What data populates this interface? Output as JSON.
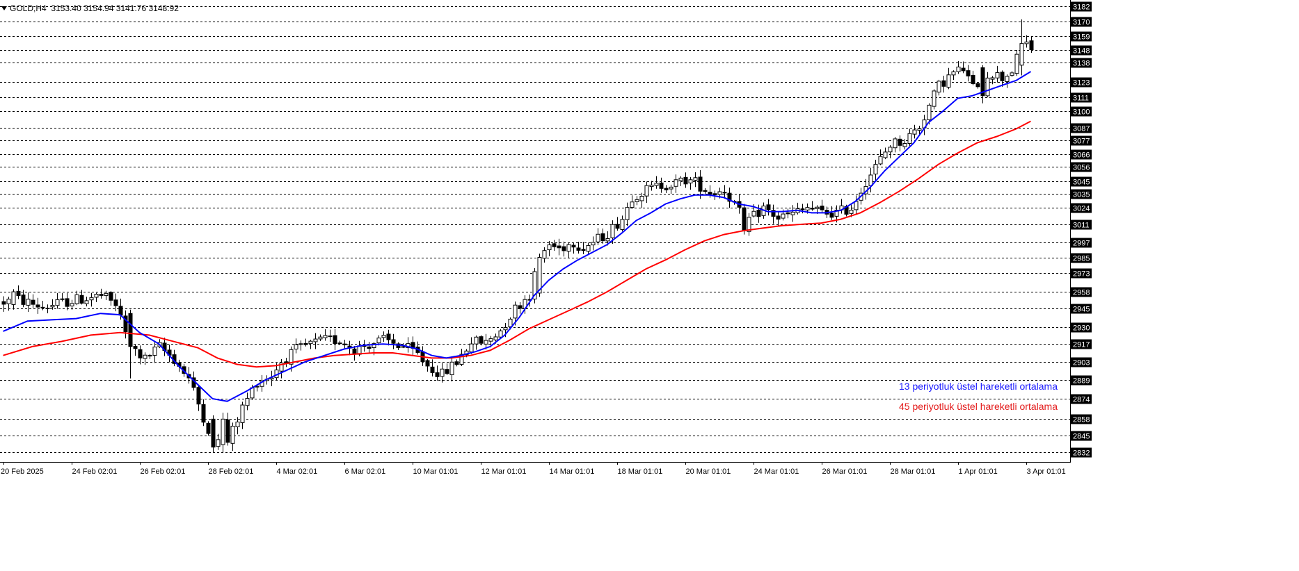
{
  "header": {
    "symbol": "GOLD,H4",
    "ohlc": "3153.40 3154.94 3141.76 3148.92"
  },
  "legend": {
    "ema13": "13 periyotluk üstel hareketli ortalama",
    "ema45": "45 periyotluk üstel hareketli ortalama"
  },
  "colors": {
    "ema13": "#0000ff",
    "ema45": "#ff0000",
    "grid": "#000000",
    "candle": "#000000",
    "background": "#ffffff"
  },
  "chart_data": {
    "type": "candlestick",
    "title": "",
    "symbol": "GOLD",
    "timeframe": "H4",
    "grid": true,
    "ylim": [
      2826,
      3185
    ],
    "y_tick_labels": [
      "3182",
      "3170",
      "3159",
      "3148",
      "3138",
      "3123",
      "3111",
      "3100",
      "3087",
      "3077",
      "3066",
      "3056",
      "3045",
      "3035",
      "3024",
      "3011",
      "2997",
      "2985",
      "2973",
      "2958",
      "2945",
      "2930",
      "2917",
      "2903",
      "2889",
      "2874",
      "2858",
      "2845",
      "2832"
    ],
    "x_tick_labels": [
      {
        "label": "20 Feb 2025",
        "bar": 0
      },
      {
        "label": "24 Feb 02:01",
        "bar": 14
      },
      {
        "label": "26 Feb 02:01",
        "bar": 28
      },
      {
        "label": "28 Feb 02:01",
        "bar": 42
      },
      {
        "label": "4 Mar 02:01",
        "bar": 56
      },
      {
        "label": "6 Mar 02:01",
        "bar": 70
      },
      {
        "label": "10 Mar 01:01",
        "bar": 84
      },
      {
        "label": "12 Mar 01:01",
        "bar": 98
      },
      {
        "label": "14 Mar 01:01",
        "bar": 112
      },
      {
        "label": "18 Mar 01:01",
        "bar": 126
      },
      {
        "label": "20 Mar 01:01",
        "bar": 140
      },
      {
        "label": "24 Mar 01:01",
        "bar": 154
      },
      {
        "label": "26 Mar 01:01",
        "bar": 168
      },
      {
        "label": "28 Mar 01:01",
        "bar": 182
      },
      {
        "label": "1 Apr 01:01",
        "bar": 196
      },
      {
        "label": "3 Apr 01:01",
        "bar": 210
      }
    ],
    "price_path": [
      [
        0,
        2950
      ],
      [
        3,
        2952
      ],
      [
        8,
        2946
      ],
      [
        14,
        2951
      ],
      [
        20,
        2955
      ],
      [
        23,
        2948
      ],
      [
        26,
        2915
      ],
      [
        29,
        2905
      ],
      [
        32,
        2915
      ],
      [
        35,
        2905
      ],
      [
        38,
        2890
      ],
      [
        40,
        2870
      ],
      [
        43,
        2840
      ],
      [
        46,
        2840
      ],
      [
        49,
        2867
      ],
      [
        52,
        2888
      ],
      [
        55,
        2892
      ],
      [
        57,
        2903
      ],
      [
        60,
        2912
      ],
      [
        63,
        2917
      ],
      [
        66,
        2920
      ],
      [
        69,
        2920
      ],
      [
        72,
        2913
      ],
      [
        75,
        2917
      ],
      [
        78,
        2920
      ],
      [
        82,
        2915
      ],
      [
        85,
        2909
      ],
      [
        87,
        2900
      ],
      [
        90,
        2893
      ],
      [
        93,
        2903
      ],
      [
        96,
        2919
      ],
      [
        99,
        2918
      ],
      [
        102,
        2928
      ],
      [
        105,
        2945
      ],
      [
        108,
        2956
      ],
      [
        110,
        2985
      ],
      [
        112,
        2995
      ],
      [
        114,
        2992
      ],
      [
        117,
        2997
      ],
      [
        119,
        2993
      ],
      [
        121,
        2997
      ],
      [
        124,
        3004
      ],
      [
        127,
        3016
      ],
      [
        129,
        3033
      ],
      [
        132,
        3038
      ],
      [
        135,
        3042
      ],
      [
        138,
        3043
      ],
      [
        140,
        3046
      ],
      [
        142,
        3044
      ],
      [
        145,
        3036
      ],
      [
        148,
        3038
      ],
      [
        150,
        3027
      ],
      [
        152,
        3013
      ],
      [
        154,
        3017
      ],
      [
        156,
        3024
      ],
      [
        159,
        3016
      ],
      [
        162,
        3019
      ],
      [
        165,
        3024
      ],
      [
        168,
        3020
      ],
      [
        171,
        3020
      ],
      [
        174,
        3024
      ],
      [
        177,
        3045
      ],
      [
        179,
        3056
      ],
      [
        182,
        3074
      ],
      [
        185,
        3077
      ],
      [
        188,
        3088
      ],
      [
        190,
        3104
      ],
      [
        192,
        3120
      ],
      [
        195,
        3130
      ],
      [
        197,
        3133
      ],
      [
        199,
        3118
      ],
      [
        201,
        3127
      ],
      [
        203,
        3130
      ],
      [
        205,
        3126
      ],
      [
        207,
        3132
      ],
      [
        208,
        3141
      ],
      [
        210,
        3153
      ],
      [
        211,
        3149
      ]
    ],
    "highlighted_candles": [
      {
        "bar": 2,
        "open": 2948,
        "close": 2958,
        "high": 2960,
        "low": 2944
      },
      {
        "bar": 26,
        "open": 2941,
        "close": 2915,
        "high": 2944,
        "low": 2890
      },
      {
        "bar": 43,
        "open": 2858,
        "close": 2836,
        "high": 2861,
        "low": 2832
      },
      {
        "bar": 45,
        "open": 2838,
        "close": 2858,
        "high": 2863,
        "low": 2832
      },
      {
        "bar": 110,
        "open": 2957,
        "close": 2985,
        "high": 2988,
        "low": 2954
      },
      {
        "bar": 152,
        "open": 3024,
        "close": 3006,
        "high": 3027,
        "low": 3003
      },
      {
        "bar": 201,
        "open": 3134,
        "close": 3112,
        "high": 3136,
        "low": 3106
      },
      {
        "bar": 209,
        "open": 3136,
        "close": 3153,
        "high": 3172,
        "low": 3128
      }
    ],
    "series": [
      {
        "name": "13 periyotluk üstel hareketli ortalama",
        "color": "#0000ff",
        "points": [
          [
            0,
            2927
          ],
          [
            5,
            2935
          ],
          [
            10,
            2936
          ],
          [
            15,
            2937
          ],
          [
            20,
            2941
          ],
          [
            24,
            2940
          ],
          [
            28,
            2926
          ],
          [
            32,
            2917
          ],
          [
            36,
            2900
          ],
          [
            40,
            2885
          ],
          [
            43,
            2874
          ],
          [
            46,
            2872
          ],
          [
            50,
            2880
          ],
          [
            54,
            2889
          ],
          [
            58,
            2896
          ],
          [
            62,
            2903
          ],
          [
            66,
            2908
          ],
          [
            70,
            2913
          ],
          [
            74,
            2916
          ],
          [
            78,
            2917
          ],
          [
            82,
            2916
          ],
          [
            85,
            2913
          ],
          [
            88,
            2908
          ],
          [
            91,
            2906
          ],
          [
            94,
            2908
          ],
          [
            97,
            2911
          ],
          [
            100,
            2915
          ],
          [
            103,
            2924
          ],
          [
            106,
            2938
          ],
          [
            109,
            2955
          ],
          [
            112,
            2967
          ],
          [
            115,
            2976
          ],
          [
            118,
            2983
          ],
          [
            121,
            2989
          ],
          [
            124,
            2995
          ],
          [
            127,
            3004
          ],
          [
            130,
            3014
          ],
          [
            133,
            3020
          ],
          [
            136,
            3027
          ],
          [
            139,
            3031
          ],
          [
            142,
            3034
          ],
          [
            145,
            3034
          ],
          [
            148,
            3032
          ],
          [
            151,
            3027
          ],
          [
            154,
            3025
          ],
          [
            157,
            3021
          ],
          [
            160,
            3021
          ],
          [
            163,
            3022
          ],
          [
            166,
            3020
          ],
          [
            169,
            3020
          ],
          [
            172,
            3022
          ],
          [
            175,
            3029
          ],
          [
            178,
            3040
          ],
          [
            181,
            3053
          ],
          [
            184,
            3064
          ],
          [
            187,
            3075
          ],
          [
            190,
            3091
          ],
          [
            193,
            3100
          ],
          [
            196,
            3110
          ],
          [
            199,
            3112
          ],
          [
            202,
            3116
          ],
          [
            205,
            3120
          ],
          [
            208,
            3124
          ],
          [
            211,
            3131
          ]
        ]
      },
      {
        "name": "45 periyotluk üstel hareketli ortalama",
        "color": "#ff0000",
        "points": [
          [
            0,
            2908
          ],
          [
            6,
            2915
          ],
          [
            12,
            2919
          ],
          [
            18,
            2924
          ],
          [
            24,
            2926
          ],
          [
            30,
            2924
          ],
          [
            36,
            2918
          ],
          [
            40,
            2914
          ],
          [
            44,
            2906
          ],
          [
            48,
            2901
          ],
          [
            52,
            2899
          ],
          [
            56,
            2900
          ],
          [
            60,
            2903
          ],
          [
            64,
            2906
          ],
          [
            68,
            2908
          ],
          [
            72,
            2909
          ],
          [
            76,
            2910
          ],
          [
            80,
            2910
          ],
          [
            84,
            2908
          ],
          [
            88,
            2906
          ],
          [
            92,
            2906
          ],
          [
            96,
            2908
          ],
          [
            100,
            2912
          ],
          [
            104,
            2920
          ],
          [
            108,
            2929
          ],
          [
            112,
            2936
          ],
          [
            116,
            2943
          ],
          [
            120,
            2950
          ],
          [
            124,
            2958
          ],
          [
            128,
            2967
          ],
          [
            132,
            2976
          ],
          [
            136,
            2983
          ],
          [
            140,
            2991
          ],
          [
            144,
            2998
          ],
          [
            148,
            3003
          ],
          [
            152,
            3006
          ],
          [
            156,
            3008
          ],
          [
            160,
            3010
          ],
          [
            164,
            3011
          ],
          [
            168,
            3012
          ],
          [
            172,
            3015
          ],
          [
            176,
            3020
          ],
          [
            180,
            3028
          ],
          [
            184,
            3037
          ],
          [
            188,
            3047
          ],
          [
            192,
            3058
          ],
          [
            196,
            3067
          ],
          [
            200,
            3075
          ],
          [
            204,
            3080
          ],
          [
            208,
            3086
          ],
          [
            211,
            3092
          ]
        ]
      }
    ]
  }
}
